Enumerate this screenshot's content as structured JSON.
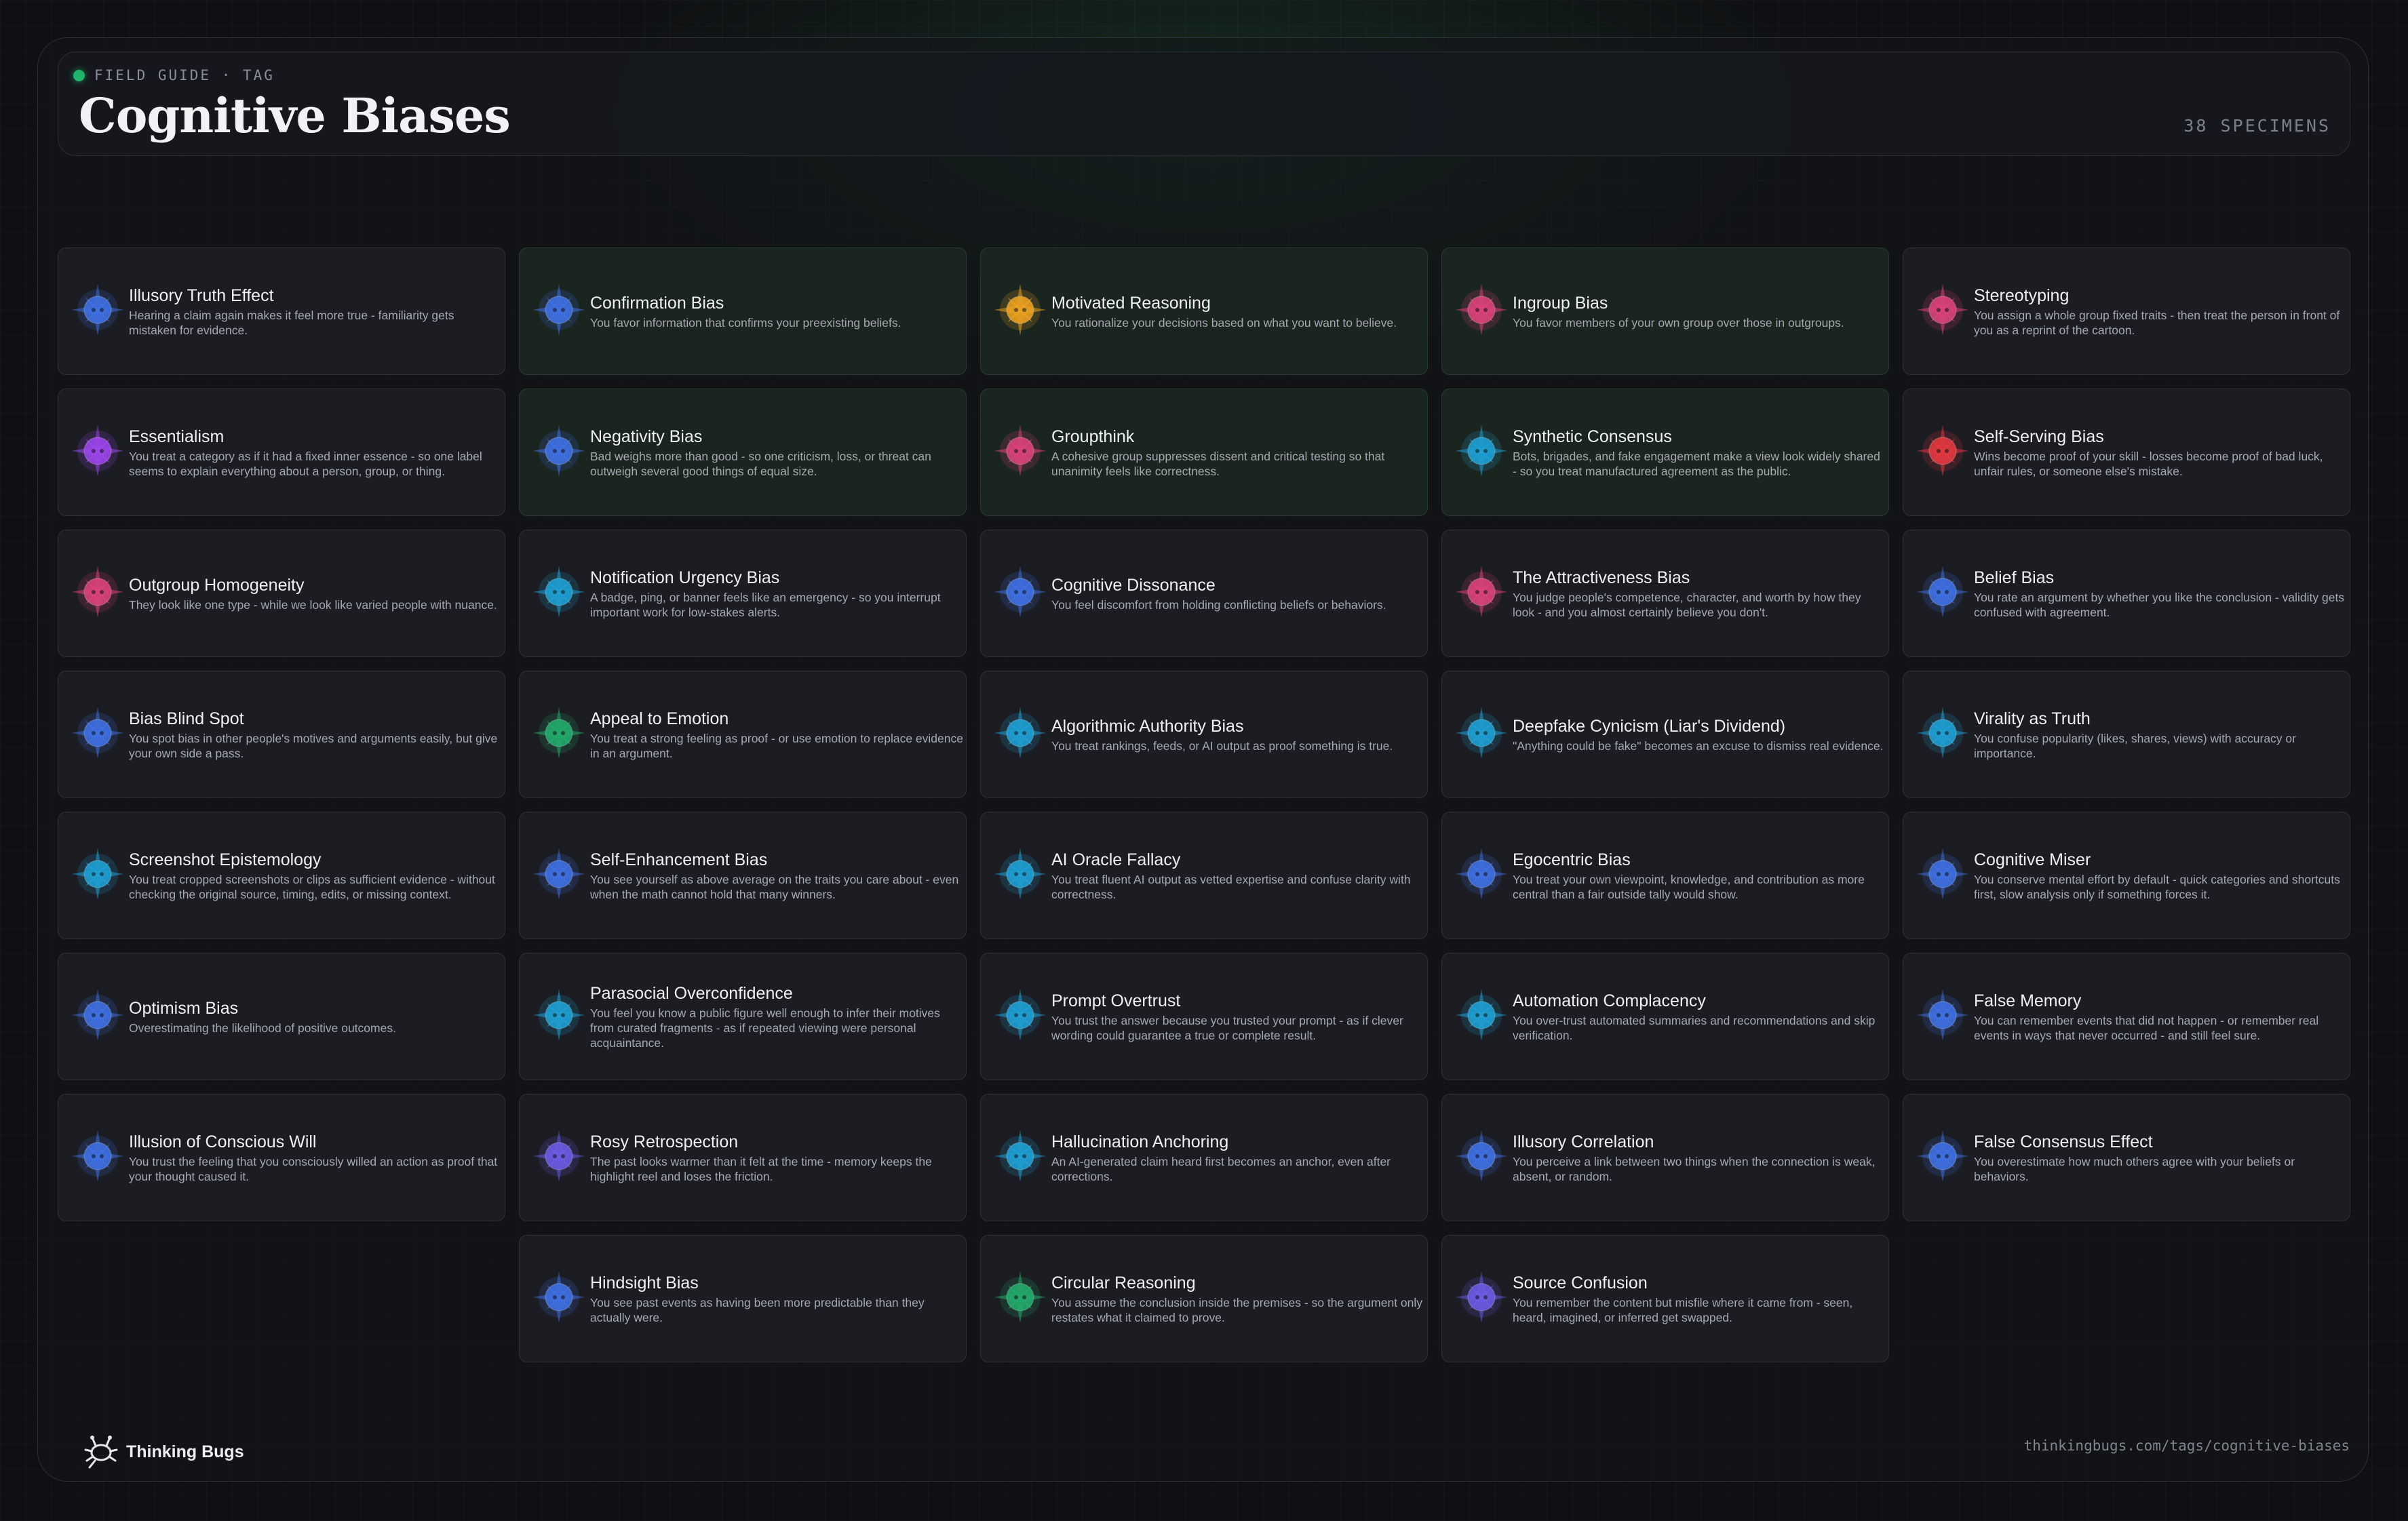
{
  "header": {
    "eyebrow": "FIELD GUIDE · TAG",
    "title": "Cognitive Biases",
    "count": "38 SPECIMENS"
  },
  "colors": {
    "accent_dot": "#1fb36b",
    "blue": "#3f6fe0",
    "teal": "#1f9fd0",
    "orange": "#e8a020",
    "pink": "#d8427a",
    "red": "#e0393f",
    "purple": "#9a46e8",
    "green": "#23a86a",
    "indigo": "#6a5be0"
  },
  "cards": [
    {
      "name": "Illusory Truth Effect",
      "desc": "Hearing a claim again makes it feel more true - familiarity gets mistaken for evidence.",
      "icon": "compass-star-icon",
      "color": "blue",
      "tint": false
    },
    {
      "name": "Confirmation Bias",
      "desc": "You favor information that confirms your preexisting beliefs.",
      "icon": "compass-star-icon",
      "color": "blue",
      "tint": true
    },
    {
      "name": "Motivated Reasoning",
      "desc": "You rationalize your decisions based on what you want to believe.",
      "icon": "compass-star-icon",
      "color": "orange",
      "tint": true
    },
    {
      "name": "Ingroup Bias",
      "desc": "You favor members of your own group over those in outgroups.",
      "icon": "compass-star-icon",
      "color": "pink",
      "tint": true
    },
    {
      "name": "Stereotyping",
      "desc": "You assign a whole group fixed traits - then treat the person in front of you as a reprint of the cartoon.",
      "icon": "compass-star-icon",
      "color": "pink",
      "tint": false
    },
    {
      "name": "Essentialism",
      "desc": "You treat a category as if it had a fixed inner essence - so one label seems to explain everything about a person, group, or thing.",
      "icon": "compass-star-icon",
      "color": "purple",
      "tint": false
    },
    {
      "name": "Negativity Bias",
      "desc": "Bad weighs more than good - so one criticism, loss, or threat can outweigh several good things of equal size.",
      "icon": "compass-star-icon",
      "color": "blue",
      "tint": true
    },
    {
      "name": "Groupthink",
      "desc": "A cohesive group suppresses dissent and critical testing so that unanimity feels like correctness.",
      "icon": "compass-star-icon",
      "color": "pink",
      "tint": true
    },
    {
      "name": "Synthetic Consensus",
      "desc": "Bots, brigades, and fake engagement make a view look widely shared - so you treat manufactured agreement as the public.",
      "icon": "compass-star-icon",
      "color": "teal",
      "tint": true
    },
    {
      "name": "Self-Serving Bias",
      "desc": "Wins become proof of your skill - losses become proof of bad luck, unfair rules, or someone else's mistake.",
      "icon": "compass-star-icon",
      "color": "red",
      "tint": false
    },
    {
      "name": "Outgroup Homogeneity",
      "desc": "They look like one type - while we look like varied people with nuance.",
      "icon": "compass-star-icon",
      "color": "pink",
      "tint": false
    },
    {
      "name": "Notification Urgency Bias",
      "desc": "A badge, ping, or banner feels like an emergency - so you interrupt important work for low-stakes alerts.",
      "icon": "compass-star-icon",
      "color": "teal",
      "tint": false
    },
    {
      "name": "Cognitive Dissonance",
      "desc": "You feel discomfort from holding conflicting beliefs or behaviors.",
      "icon": "compass-star-icon",
      "color": "blue",
      "tint": false
    },
    {
      "name": "The Attractiveness Bias",
      "desc": "You judge people's competence, character, and worth by how they look - and you almost certainly believe you don't.",
      "icon": "compass-star-icon",
      "color": "pink",
      "tint": false
    },
    {
      "name": "Belief Bias",
      "desc": "You rate an argument by whether you like the conclusion - validity gets confused with agreement.",
      "icon": "compass-star-icon",
      "color": "blue",
      "tint": false
    },
    {
      "name": "Bias Blind Spot",
      "desc": "You spot bias in other people's motives and arguments easily, but give your own side a pass.",
      "icon": "compass-star-icon",
      "color": "blue",
      "tint": false
    },
    {
      "name": "Appeal to Emotion",
      "desc": "You treat a strong feeling as proof - or use emotion to replace evidence in an argument.",
      "icon": "compass-star-icon",
      "color": "green",
      "tint": false
    },
    {
      "name": "Algorithmic Authority Bias",
      "desc": "You treat rankings, feeds, or AI output as proof something is true.",
      "icon": "compass-star-icon",
      "color": "teal",
      "tint": false
    },
    {
      "name": "Deepfake Cynicism (Liar's Dividend)",
      "desc": "\"Anything could be fake\" becomes an excuse to dismiss real evidence.",
      "icon": "compass-star-icon",
      "color": "teal",
      "tint": false
    },
    {
      "name": "Virality as Truth",
      "desc": "You confuse popularity (likes, shares, views) with accuracy or importance.",
      "icon": "compass-star-icon",
      "color": "teal",
      "tint": false
    },
    {
      "name": "Screenshot Epistemology",
      "desc": "You treat cropped screenshots or clips as sufficient evidence - without checking the original source, timing, edits, or missing context.",
      "icon": "compass-star-icon",
      "color": "teal",
      "tint": false
    },
    {
      "name": "Self-Enhancement Bias",
      "desc": "You see yourself as above average on the traits you care about - even when the math cannot hold that many winners.",
      "icon": "compass-star-icon",
      "color": "blue",
      "tint": false
    },
    {
      "name": "AI Oracle Fallacy",
      "desc": "You treat fluent AI output as vetted expertise and confuse clarity with correctness.",
      "icon": "compass-star-icon",
      "color": "teal",
      "tint": false
    },
    {
      "name": "Egocentric Bias",
      "desc": "You treat your own viewpoint, knowledge, and contribution as more central than a fair outside tally would show.",
      "icon": "compass-star-icon",
      "color": "blue",
      "tint": false
    },
    {
      "name": "Cognitive Miser",
      "desc": "You conserve mental effort by default - quick categories and shortcuts first, slow analysis only if something forces it.",
      "icon": "compass-star-icon",
      "color": "blue",
      "tint": false
    },
    {
      "name": "Optimism Bias",
      "desc": "Overestimating the likelihood of positive outcomes.",
      "icon": "compass-star-icon",
      "color": "blue",
      "tint": false
    },
    {
      "name": "Parasocial Overconfidence",
      "desc": "You feel you know a public figure well enough to infer their motives from curated fragments - as if repeated viewing were personal acquaintance.",
      "icon": "compass-star-icon",
      "color": "teal",
      "tint": false
    },
    {
      "name": "Prompt Overtrust",
      "desc": "You trust the answer because you trusted your prompt - as if clever wording could guarantee a true or complete result.",
      "icon": "compass-star-icon",
      "color": "teal",
      "tint": false
    },
    {
      "name": "Automation Complacency",
      "desc": "You over-trust automated summaries and recommendations and skip verification.",
      "icon": "compass-star-icon",
      "color": "teal",
      "tint": false
    },
    {
      "name": "False Memory",
      "desc": "You can remember events that did not happen - or remember real events in ways that never occurred - and still feel sure.",
      "icon": "compass-star-icon",
      "color": "blue",
      "tint": false
    },
    {
      "name": "Illusion of Conscious Will",
      "desc": "You trust the feeling that you consciously willed an action as proof that your thought caused it.",
      "icon": "compass-star-icon",
      "color": "blue",
      "tint": false
    },
    {
      "name": "Rosy Retrospection",
      "desc": "The past looks warmer than it felt at the time - memory keeps the highlight reel and loses the friction.",
      "icon": "compass-star-icon",
      "color": "indigo",
      "tint": false
    },
    {
      "name": "Hallucination Anchoring",
      "desc": "An AI-generated claim heard first becomes an anchor, even after corrections.",
      "icon": "compass-star-icon",
      "color": "teal",
      "tint": false
    },
    {
      "name": "Illusory Correlation",
      "desc": "You perceive a link between two things when the connection is weak, absent, or random.",
      "icon": "compass-star-icon",
      "color": "blue",
      "tint": false
    },
    {
      "name": "False Consensus Effect",
      "desc": "You overestimate how much others agree with your beliefs or behaviors.",
      "icon": "compass-star-icon",
      "color": "blue",
      "tint": false
    },
    {
      "name": "Hindsight Bias",
      "desc": "You see past events as having been more predictable than they actually were.",
      "icon": "compass-star-icon",
      "color": "blue",
      "tint": false
    },
    {
      "name": "Circular Reasoning",
      "desc": "You assume the conclusion inside the premises - so the argument only restates what it claimed to prove.",
      "icon": "compass-star-icon",
      "color": "green",
      "tint": false
    },
    {
      "name": "Source Confusion",
      "desc": "You remember the content but misfile where it came from - seen, heard, imagined, or inferred get swapped.",
      "icon": "compass-star-icon",
      "color": "indigo",
      "tint": false
    }
  ],
  "footer": {
    "brand": "Thinking Bugs",
    "logo_icon": "bug-logo-icon",
    "url": "thinkingbugs.com/tags/cognitive-biases"
  }
}
